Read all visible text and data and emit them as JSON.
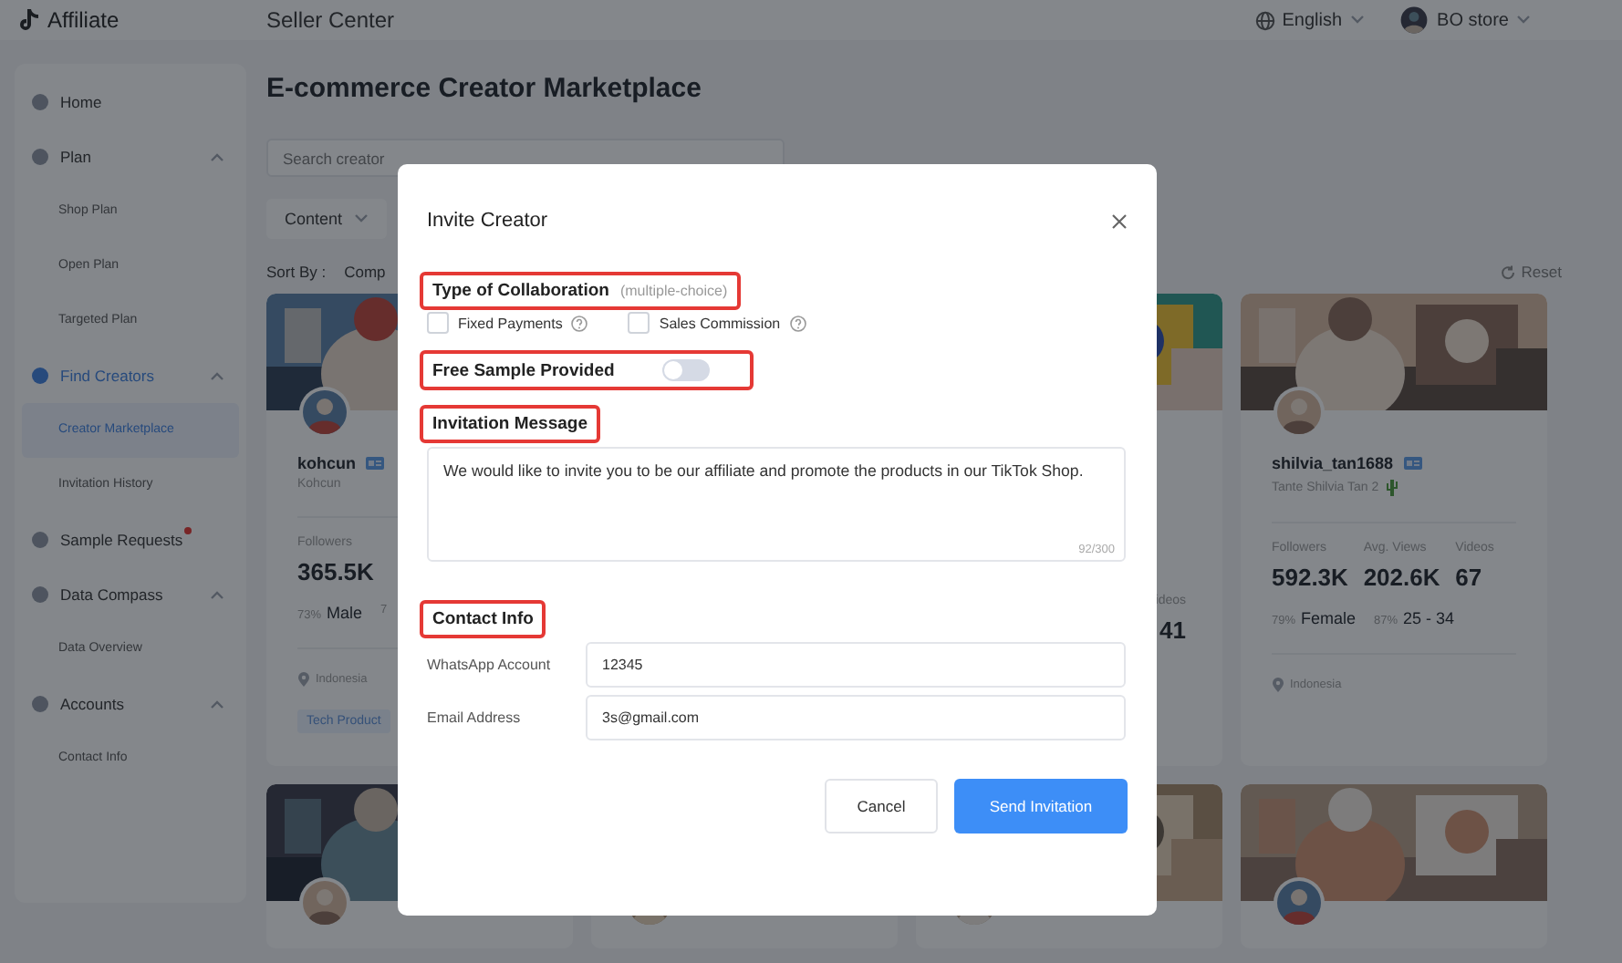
{
  "header": {
    "logo_text": "Affiliate",
    "title": "Seller Center",
    "language": "English",
    "store": "BO store"
  },
  "sidebar": {
    "items": [
      {
        "label": "Home",
        "selected": false,
        "alert": false
      },
      {
        "label": "Plan",
        "selected": false,
        "alert": false,
        "expanded": true,
        "children": [
          {
            "label": "Shop Plan",
            "selected": false
          },
          {
            "label": "Open Plan",
            "selected": false
          },
          {
            "label": "Targeted Plan",
            "selected": false
          }
        ]
      },
      {
        "label": "Find Creators",
        "selected": true,
        "alert": false,
        "expanded": true,
        "children": [
          {
            "label": "Creator Marketplace",
            "selected": true
          },
          {
            "label": "Invitation History",
            "selected": false
          }
        ]
      },
      {
        "label": "Sample Requests",
        "selected": false,
        "alert": true
      },
      {
        "label": "Data Compass",
        "selected": false,
        "alert": false,
        "expanded": true,
        "children": [
          {
            "label": "Data Overview",
            "selected": false
          }
        ]
      },
      {
        "label": "Accounts",
        "selected": false,
        "alert": false,
        "expanded": true,
        "children": [
          {
            "label": "Contact Info",
            "selected": false
          }
        ]
      }
    ]
  },
  "page": {
    "title": "E-commerce Creator Marketplace",
    "search": {
      "placeholder": "Search creator"
    },
    "filters": [
      {
        "label": "Content"
      }
    ],
    "sort": {
      "label": "Sort By :",
      "option": "Comp"
    },
    "reset": "Reset"
  },
  "cards": [
    {
      "kind": "full",
      "name": "kohcun",
      "nickname": "Kohcun",
      "stats": [
        {
          "label": "Followers",
          "value": "365.5K"
        }
      ],
      "audience": [
        {
          "share": "73%",
          "label": "Male"
        },
        {
          "share": "7"
        }
      ],
      "location": "Indonesia",
      "tags": [
        "Tech Product"
      ]
    },
    {
      "kind": "partial",
      "stats": [
        {
          "label": "ideos",
          "value": "41"
        }
      ]
    },
    {
      "kind": "full",
      "name": "shilvia_tan1688",
      "nickname": "Tante Shilvia Tan 2",
      "stats": [
        {
          "label": "Followers",
          "value": "592.3K"
        },
        {
          "label": "Avg. Views",
          "value": "202.6K"
        },
        {
          "label": "Videos",
          "value": "67"
        }
      ],
      "audience": [
        {
          "share": "79%",
          "label": "Female"
        },
        {
          "share": "87%",
          "label": "25 - 34"
        }
      ],
      "location": "Indonesia"
    }
  ],
  "second_row": [
    {
      "kind": "picture"
    },
    {
      "kind": "avatar"
    },
    {
      "kind": "picture"
    },
    {
      "kind": "picture"
    }
  ],
  "dialog": {
    "title": "Invite Creator",
    "collaboration": {
      "label": "Type of Collaboration",
      "hint": "(multiple-choice)",
      "highlighted": true,
      "options": [
        {
          "label": "Fixed Payments",
          "checked": false
        },
        {
          "label": "Sales Commission",
          "checked": false
        }
      ]
    },
    "free_sample": {
      "label": "Free Sample Provided",
      "on": false,
      "highlighted": true
    },
    "message": {
      "label": "Invitation Message",
      "highlighted": true,
      "value": "We would like to invite you to be our affiliate and promote the products in our TikTok Shop.",
      "counter": "92/300"
    },
    "contact": {
      "label": "Contact Info",
      "highlighted": true,
      "fields": [
        {
          "label": "WhatsApp Account",
          "value": "12345"
        },
        {
          "label": "Email Address",
          "value": "3s@gmail.com"
        }
      ]
    },
    "buttons": [
      {
        "label": "Cancel",
        "kind": "secondary"
      },
      {
        "label": "Send Invitation",
        "kind": "primary"
      }
    ]
  }
}
